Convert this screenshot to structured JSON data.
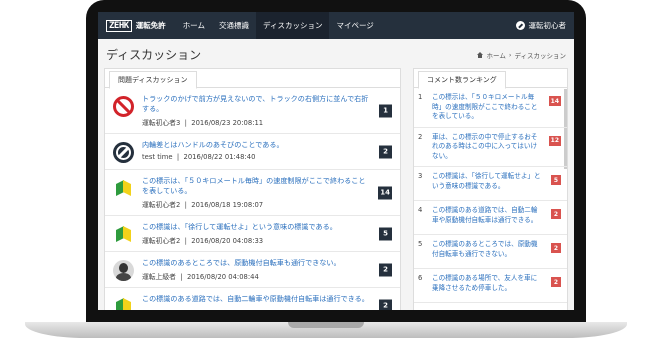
{
  "nav": {
    "logo_mark": "ZEHK",
    "logo_text": "運転免許",
    "items": [
      "ホーム",
      "交通標識",
      "ディスカッション",
      "マイページ"
    ],
    "active_index": 2,
    "user_name": "運転初心者"
  },
  "page": {
    "title": "ディスカッション",
    "breadcrumb_home": "ホーム",
    "breadcrumb_sep": "›",
    "breadcrumb_current": "ディスカッション"
  },
  "topics": {
    "tab_label": "問題ディスカッション",
    "items": [
      {
        "icon": "no-entry-sign-icon",
        "title": "トラックのかげで前方が見えないので、トラックの右側方に並んで右折する。",
        "author": "運転初心者3",
        "date": "2016/08/23 20:08:11",
        "count": "1"
      },
      {
        "icon": "user-avatar-icon",
        "title": "内輪差とはハンドルのあそびのことである。",
        "author": "test time",
        "date": "2016/08/22 01:48:40",
        "count": "2"
      },
      {
        "icon": "beginner-mark-icon",
        "title": "この標示は、「５０キロメートル毎時」の速度制限がここで終わることを表している。",
        "author": "運転初心者2",
        "date": "2016/08/18 19:08:07",
        "count": "14"
      },
      {
        "icon": "beginner-mark-icon",
        "title": "この標識は、「徐行して運転せよ」という意味の標識である。",
        "author": "運転初心者2",
        "date": "2016/08/20 04:08:33",
        "count": "5"
      },
      {
        "icon": "user-photo-icon",
        "title": "この標識のあるところでは、原動機付自転車も通行できない。",
        "author": "運転上級者",
        "date": "2016/08/20 04:08:44",
        "count": "2"
      },
      {
        "icon": "beginner-mark-icon",
        "title": "この標識のある道路では、自動二輪車や原動機付自転車は通行できる。",
        "author": "",
        "date": "",
        "count": "2"
      }
    ],
    "meta_sep": "|"
  },
  "ranking": {
    "tab_label": "コメント数ランキング",
    "items": [
      {
        "rank": "1",
        "text": "この標示は、「５０キロメートル毎時」の速度制限がここで終わることを表している。",
        "count": "14"
      },
      {
        "rank": "2",
        "text": "車は、この標示の中で停止するおそれのある時はこの中に入ってはいけない。",
        "count": "12"
      },
      {
        "rank": "3",
        "text": "この標識は、「徐行して運転せよ」という意味の標識である。",
        "count": "5"
      },
      {
        "rank": "4",
        "text": "この標識のある道路では、自動二輪車や原動機付自転車は通行できる。",
        "count": "2"
      },
      {
        "rank": "5",
        "text": "この標識のあるところでは、原動機付自転車も通行できない。",
        "count": "2"
      },
      {
        "rank": "6",
        "text": "この標識のある場所で、友人を車に乗降させるため停車した。",
        "count": "2"
      }
    ]
  },
  "colors": {
    "navbar": "#25303d",
    "link": "#2a6fbd",
    "badge_dark": "#25303d",
    "badge_red": "#d9534f"
  }
}
